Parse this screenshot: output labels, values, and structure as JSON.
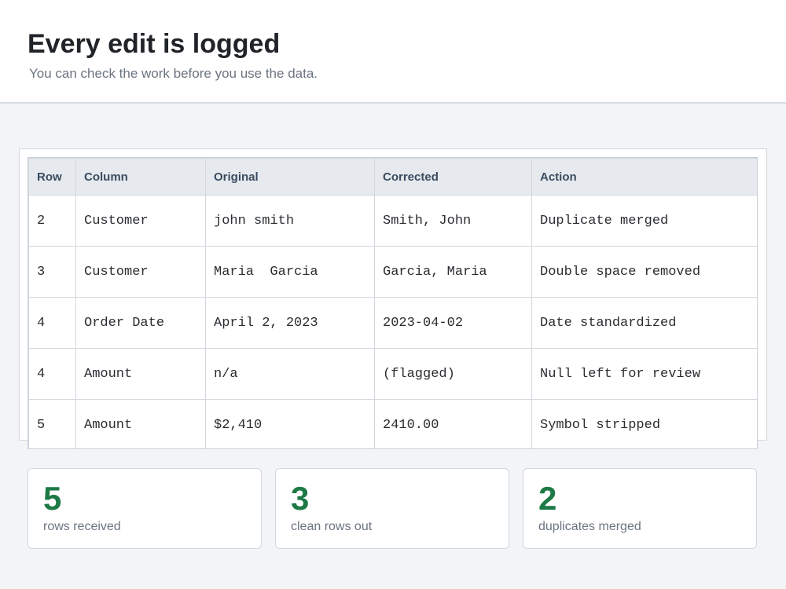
{
  "header": {
    "title": "Every edit is logged",
    "subtitle": "You can check the work before you use the data."
  },
  "table": {
    "columns": [
      "Row",
      "Column",
      "Original",
      "Corrected",
      "Action"
    ],
    "rows": [
      [
        "2",
        "Customer",
        "john smith",
        "Smith, John",
        "Duplicate merged"
      ],
      [
        "3",
        "Customer",
        "Maria  Garcia",
        "Garcia, Maria",
        "Double space removed"
      ],
      [
        "4",
        "Order Date",
        "April 2, 2023",
        "2023-04-02",
        "Date standardized"
      ],
      [
        "4",
        "Amount",
        "n/a",
        "(flagged)",
        "Null left for review"
      ],
      [
        "5",
        "Amount",
        "$2,410",
        "2410.00",
        "Symbol stripped"
      ],
      [
        "",
        "",
        "",
        "",
        ""
      ]
    ]
  },
  "stats": [
    {
      "value": "5",
      "label": "rows received"
    },
    {
      "value": "3",
      "label": "clean rows out"
    },
    {
      "value": "2",
      "label": "duplicates merged"
    }
  ],
  "colors": {
    "accent_green": "#1d7a46",
    "header_bg": "#ffffff",
    "page_bg": "#f3f4f6",
    "table_header_bg": "#e6eaee"
  }
}
